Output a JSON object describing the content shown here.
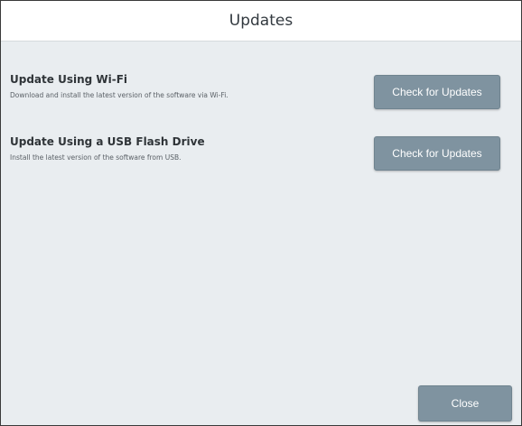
{
  "dialog": {
    "title": "Updates"
  },
  "options": [
    {
      "title": "Update Using Wi-Fi",
      "description": "Download and install the latest version of the software via Wi-Fi.",
      "button_label": "Check for Updates"
    },
    {
      "title": "Update Using a USB Flash Drive",
      "description": "Install the latest version of the software from USB.",
      "button_label": "Check for Updates"
    }
  ],
  "footer": {
    "close_label": "Close"
  },
  "colors": {
    "button": "#7f93a0",
    "panel_background": "#e9edf0",
    "header_background": "#ffffff"
  }
}
